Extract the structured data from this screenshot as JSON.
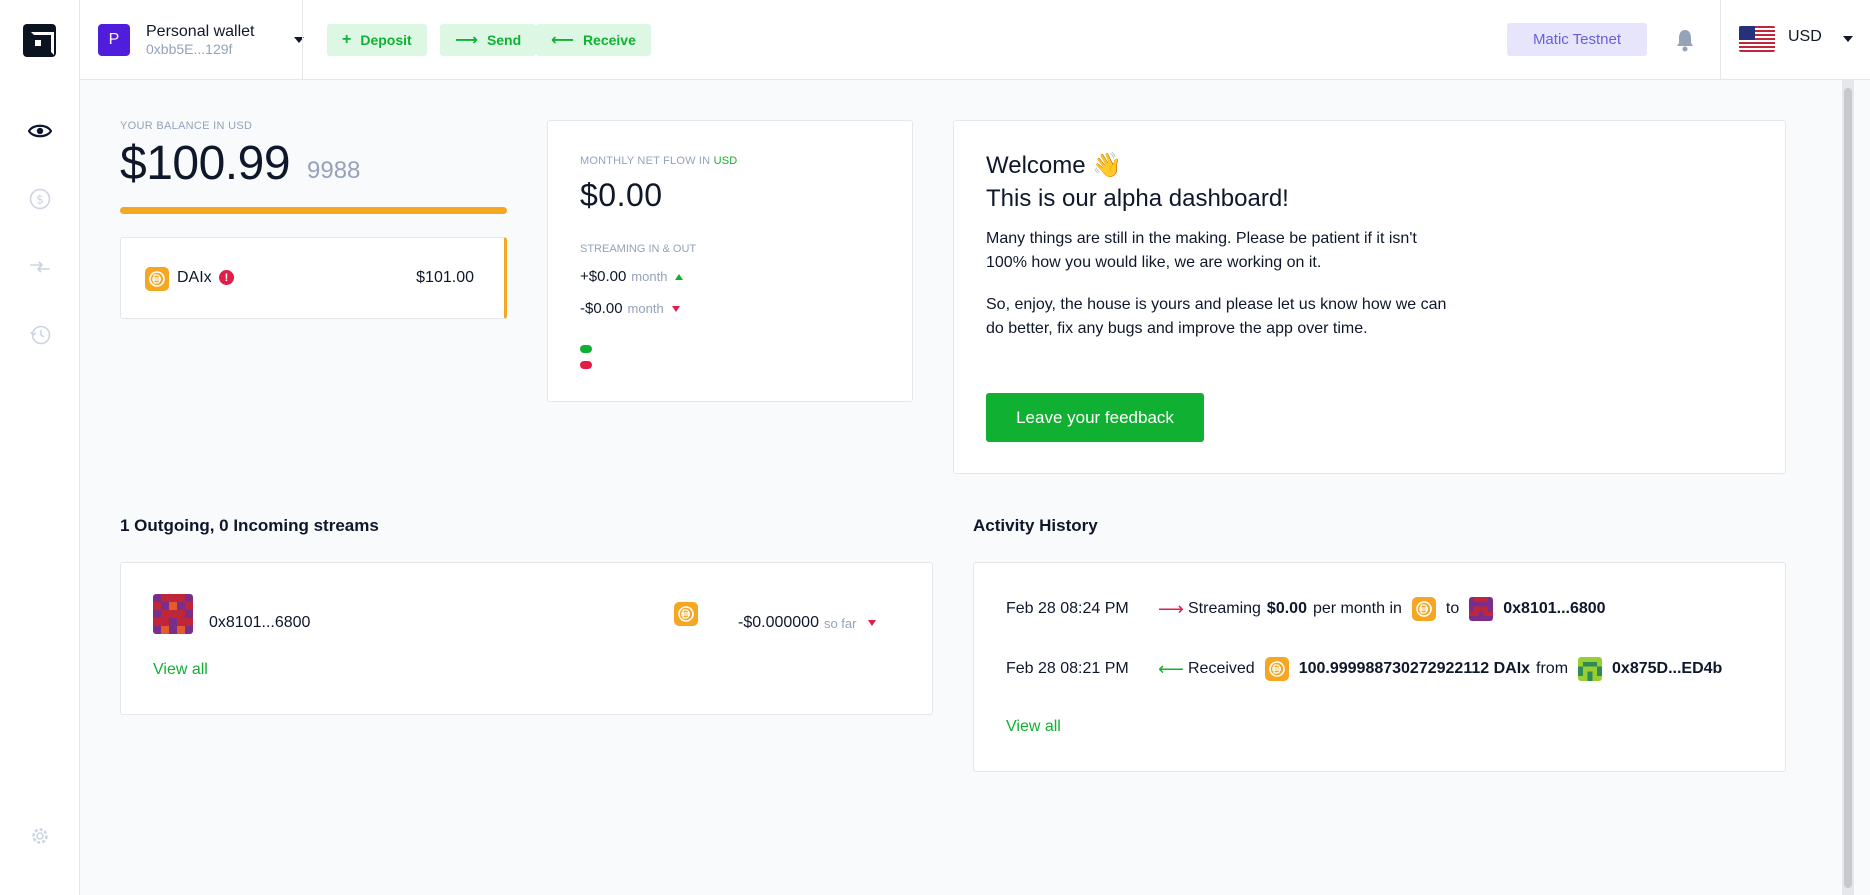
{
  "sidebar": {
    "icons": [
      "eye-icon",
      "dollar-icon",
      "swap-icon",
      "history-icon",
      "gear-icon"
    ]
  },
  "topbar": {
    "wallet_initial": "P",
    "wallet_name": "Personal wallet",
    "wallet_address": "0xbb5E...129f",
    "actions": {
      "deposit": "Deposit",
      "send": "Send",
      "receive": "Receive"
    },
    "network": "Matic Testnet",
    "currency": "USD"
  },
  "balance": {
    "label": "YOUR BALANCE IN USD",
    "amount": "$100.99",
    "decimals": "9988",
    "token": {
      "name": "DAIx",
      "alert": "!",
      "value": "$101.00"
    }
  },
  "netflow": {
    "label_prefix": "MONTHLY NET FLOW IN ",
    "label_currency": "USD",
    "amount": "$0.00",
    "streaming_label": "STREAMING IN & OUT",
    "in_amount": "+$0.00",
    "in_per": "month",
    "out_amount": "-$0.00",
    "out_per": "month"
  },
  "welcome": {
    "title_line1": "Welcome",
    "emoji": "👋",
    "title_line2": "This is our alpha dashboard!",
    "para1": "Many things are still in the making. Please be patient if it isn't 100% how you would like, we are working on it.",
    "para2": "So, enjoy, the house is yours and please let us know how we can do better, fix any bugs and improve the app over time.",
    "button": "Leave your feedback"
  },
  "streams": {
    "title": "1 Outgoing, 0 Incoming streams",
    "items": [
      {
        "address": "0x8101...6800",
        "amount": "-$0.000000",
        "suffix": "so far"
      }
    ],
    "view_all": "View all"
  },
  "activity": {
    "title": "Activity History",
    "items": [
      {
        "date": "Feb 28 08:24 PM",
        "action": "Streaming",
        "amount": "$0.00",
        "mid": "per month in",
        "connector": "to",
        "address": "0x8101...6800"
      },
      {
        "date": "Feb 28 08:21 PM",
        "action": "Received",
        "amount": "100.999988730272922112 DAIx",
        "connector": "from",
        "address": "0x875D...ED4b"
      }
    ],
    "view_all": "View all"
  },
  "colors": {
    "accent_green": "#10b132",
    "token_orange": "#f5a623",
    "wallet_purple": "#4f1ddb",
    "network_bg": "#e7e5fb",
    "error_red": "#e11d48"
  }
}
